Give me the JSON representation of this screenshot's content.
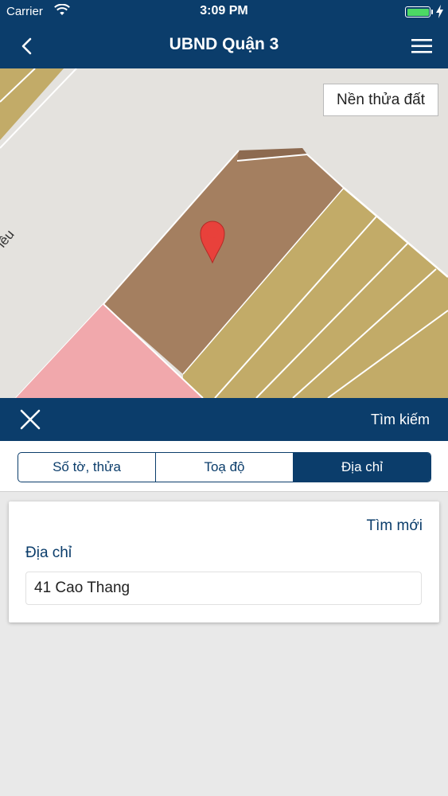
{
  "status_bar": {
    "carrier": "Carrier",
    "time": "3:09 PM",
    "icons": [
      "wifi-icon",
      "battery-icon",
      "charging-bolt-icon"
    ],
    "battery_color": "#4cd964"
  },
  "nav_bar": {
    "title": "UBND Quận 3",
    "left_icon": "back-chevron-icon",
    "right_icon": "hamburger-menu-icon",
    "background": "#0b3d6b"
  },
  "map": {
    "layer_button_label": "Nền thửa đất",
    "street_label_fragment": "iều",
    "marker_icon": "map-pin-icon",
    "parcel_colors": {
      "selected": "#a47f60",
      "residential": "#c2ab68",
      "pink": "#f1a8ac",
      "background": "#e4e2de"
    }
  },
  "search_panel": {
    "close_icon": "close-icon",
    "title": "Tìm kiếm",
    "tabs": [
      {
        "label": "Số tờ, thửa",
        "active": false
      },
      {
        "label": "Toạ độ",
        "active": false
      },
      {
        "label": "Địa chỉ",
        "active": true
      }
    ],
    "new_search_label": "Tìm mới",
    "address_label": "Địa chỉ",
    "address_value": "41 Cao Thang"
  }
}
